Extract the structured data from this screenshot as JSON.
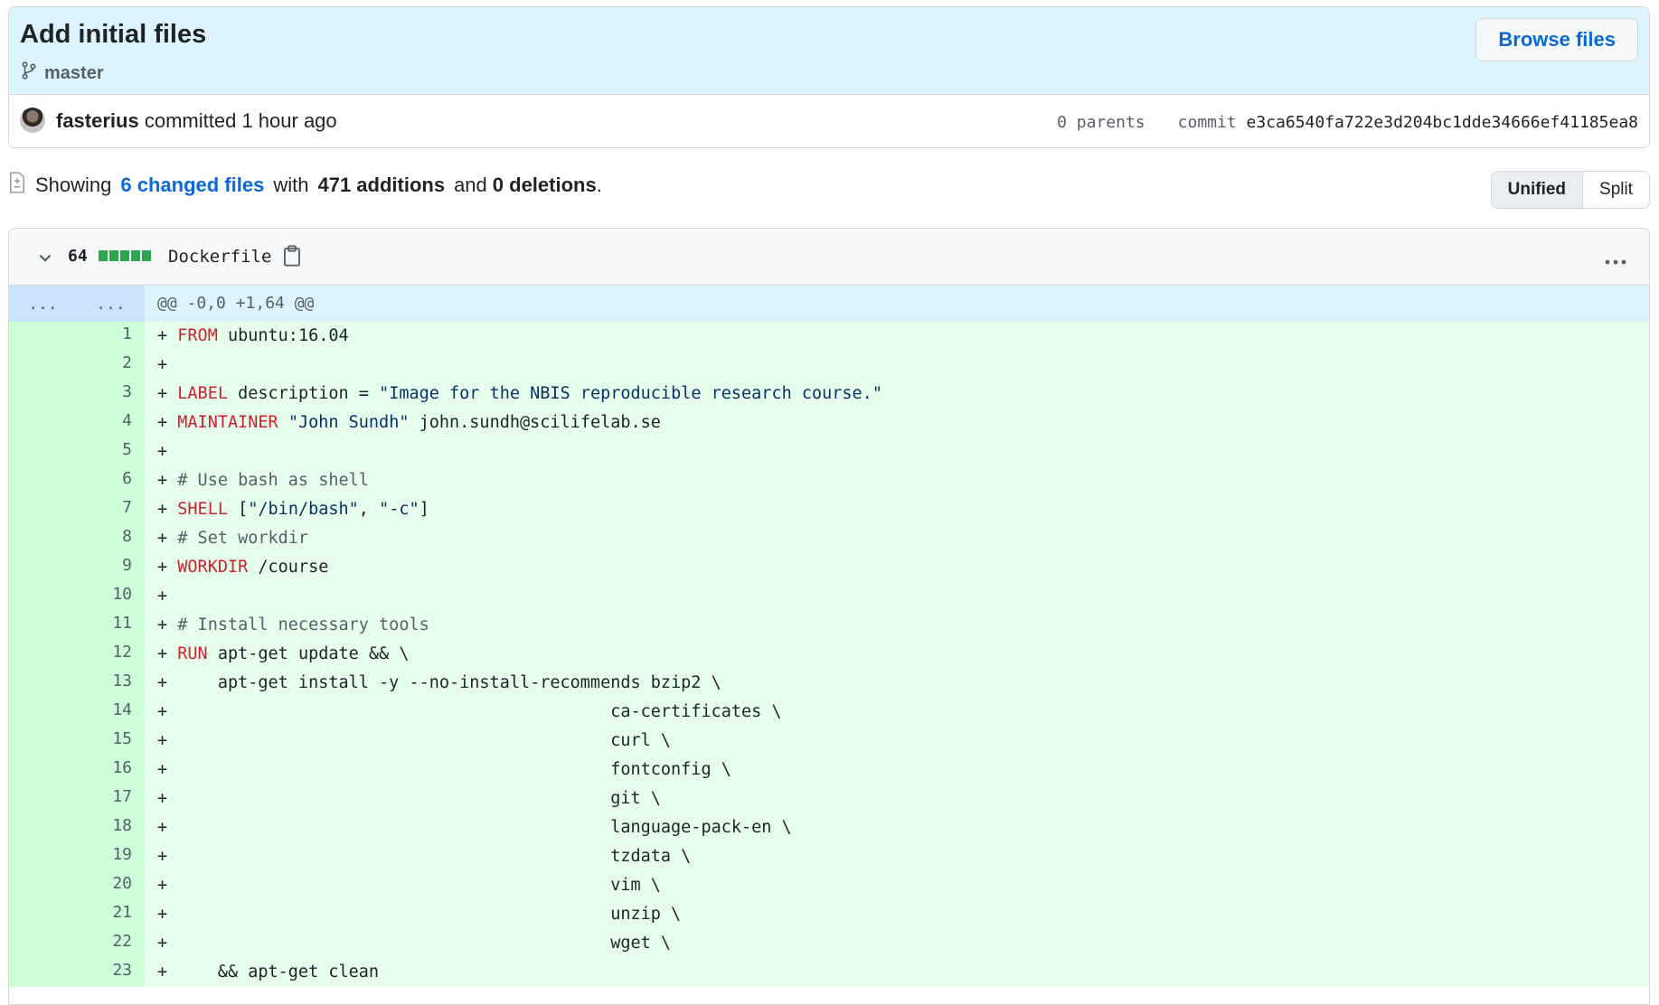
{
  "commit": {
    "title": "Add initial files",
    "branch": "master",
    "browse_label": "Browse files",
    "author": "fasterius",
    "action": "committed",
    "time": "1 hour ago",
    "parents": "0 parents",
    "commit_label": "commit",
    "sha": "e3ca6540fa722e3d204bc1dde34666ef41185ea8"
  },
  "summary": {
    "showing": "Showing",
    "changed_files": "6 changed files",
    "with": "with",
    "additions": "471 additions",
    "and": "and",
    "deletions": "0 deletions",
    "period": "."
  },
  "view_toggle": {
    "unified": "Unified",
    "split": "Split",
    "active": "Unified"
  },
  "file": {
    "changes": "64",
    "name": "Dockerfile",
    "expander_old": "...",
    "expander_new": "...",
    "hunk": "@@ -0,0 +1,64 @@",
    "lines": [
      {
        "n": "1",
        "tokens": [
          {
            "t": "+ ",
            "c": ""
          },
          {
            "t": "FROM",
            "c": "kw"
          },
          {
            "t": " ubuntu:16.04",
            "c": ""
          }
        ]
      },
      {
        "n": "2",
        "tokens": [
          {
            "t": "+",
            "c": ""
          }
        ]
      },
      {
        "n": "3",
        "tokens": [
          {
            "t": "+ ",
            "c": ""
          },
          {
            "t": "LABEL",
            "c": "kw"
          },
          {
            "t": " description = ",
            "c": ""
          },
          {
            "t": "\"Image for the NBIS reproducible research course.\"",
            "c": "str"
          }
        ]
      },
      {
        "n": "4",
        "tokens": [
          {
            "t": "+ ",
            "c": ""
          },
          {
            "t": "MAINTAINER",
            "c": "kw"
          },
          {
            "t": " ",
            "c": ""
          },
          {
            "t": "\"John Sundh\"",
            "c": "str"
          },
          {
            "t": " john.sundh@scilifelab.se",
            "c": ""
          }
        ]
      },
      {
        "n": "5",
        "tokens": [
          {
            "t": "+",
            "c": ""
          }
        ]
      },
      {
        "n": "6",
        "tokens": [
          {
            "t": "+ ",
            "c": ""
          },
          {
            "t": "# Use bash as shell",
            "c": "cmt"
          }
        ]
      },
      {
        "n": "7",
        "tokens": [
          {
            "t": "+ ",
            "c": ""
          },
          {
            "t": "SHELL",
            "c": "kw"
          },
          {
            "t": " [",
            "c": ""
          },
          {
            "t": "\"/bin/bash\"",
            "c": "str"
          },
          {
            "t": ", ",
            "c": ""
          },
          {
            "t": "\"-c\"",
            "c": "str"
          },
          {
            "t": "]",
            "c": ""
          }
        ]
      },
      {
        "n": "8",
        "tokens": [
          {
            "t": "+ ",
            "c": ""
          },
          {
            "t": "# Set workdir",
            "c": "cmt"
          }
        ]
      },
      {
        "n": "9",
        "tokens": [
          {
            "t": "+ ",
            "c": ""
          },
          {
            "t": "WORKDIR",
            "c": "kw"
          },
          {
            "t": " /course",
            "c": ""
          }
        ]
      },
      {
        "n": "10",
        "tokens": [
          {
            "t": "+",
            "c": ""
          }
        ]
      },
      {
        "n": "11",
        "tokens": [
          {
            "t": "+ ",
            "c": ""
          },
          {
            "t": "# Install necessary tools",
            "c": "cmt"
          }
        ]
      },
      {
        "n": "12",
        "tokens": [
          {
            "t": "+ ",
            "c": ""
          },
          {
            "t": "RUN",
            "c": "kw"
          },
          {
            "t": " apt-get update && \\",
            "c": ""
          }
        ]
      },
      {
        "n": "13",
        "tokens": [
          {
            "t": "+     apt-get install -y --no-install-recommends bzip2 \\",
            "c": ""
          }
        ]
      },
      {
        "n": "14",
        "tokens": [
          {
            "t": "+                                            ca-certificates \\",
            "c": ""
          }
        ]
      },
      {
        "n": "15",
        "tokens": [
          {
            "t": "+                                            curl \\",
            "c": ""
          }
        ]
      },
      {
        "n": "16",
        "tokens": [
          {
            "t": "+                                            fontconfig \\",
            "c": ""
          }
        ]
      },
      {
        "n": "17",
        "tokens": [
          {
            "t": "+                                            git \\",
            "c": ""
          }
        ]
      },
      {
        "n": "18",
        "tokens": [
          {
            "t": "+                                            language-pack-en \\",
            "c": ""
          }
        ]
      },
      {
        "n": "19",
        "tokens": [
          {
            "t": "+                                            tzdata \\",
            "c": ""
          }
        ]
      },
      {
        "n": "20",
        "tokens": [
          {
            "t": "+                                            vim \\",
            "c": ""
          }
        ]
      },
      {
        "n": "21",
        "tokens": [
          {
            "t": "+                                            unzip \\",
            "c": ""
          }
        ]
      },
      {
        "n": "22",
        "tokens": [
          {
            "t": "+                                            wget \\",
            "c": ""
          }
        ]
      },
      {
        "n": "23",
        "tokens": [
          {
            "t": "+     && apt-get clean",
            "c": ""
          }
        ]
      }
    ]
  },
  "icons": {
    "branch": "git-branch-icon",
    "chevron": "chevron-down-icon",
    "clipboard": "clipboard-icon",
    "kebab": "kebab-horizontal-icon",
    "file_diff": "file-diff-icon"
  },
  "colors": {
    "accent": "#0969da",
    "addition_bg": "#e6ffec",
    "addition_gutter": "#ccffd8",
    "hunk_bg": "#ddf4ff",
    "keyword": "#cf222e",
    "string": "#0a3069"
  }
}
